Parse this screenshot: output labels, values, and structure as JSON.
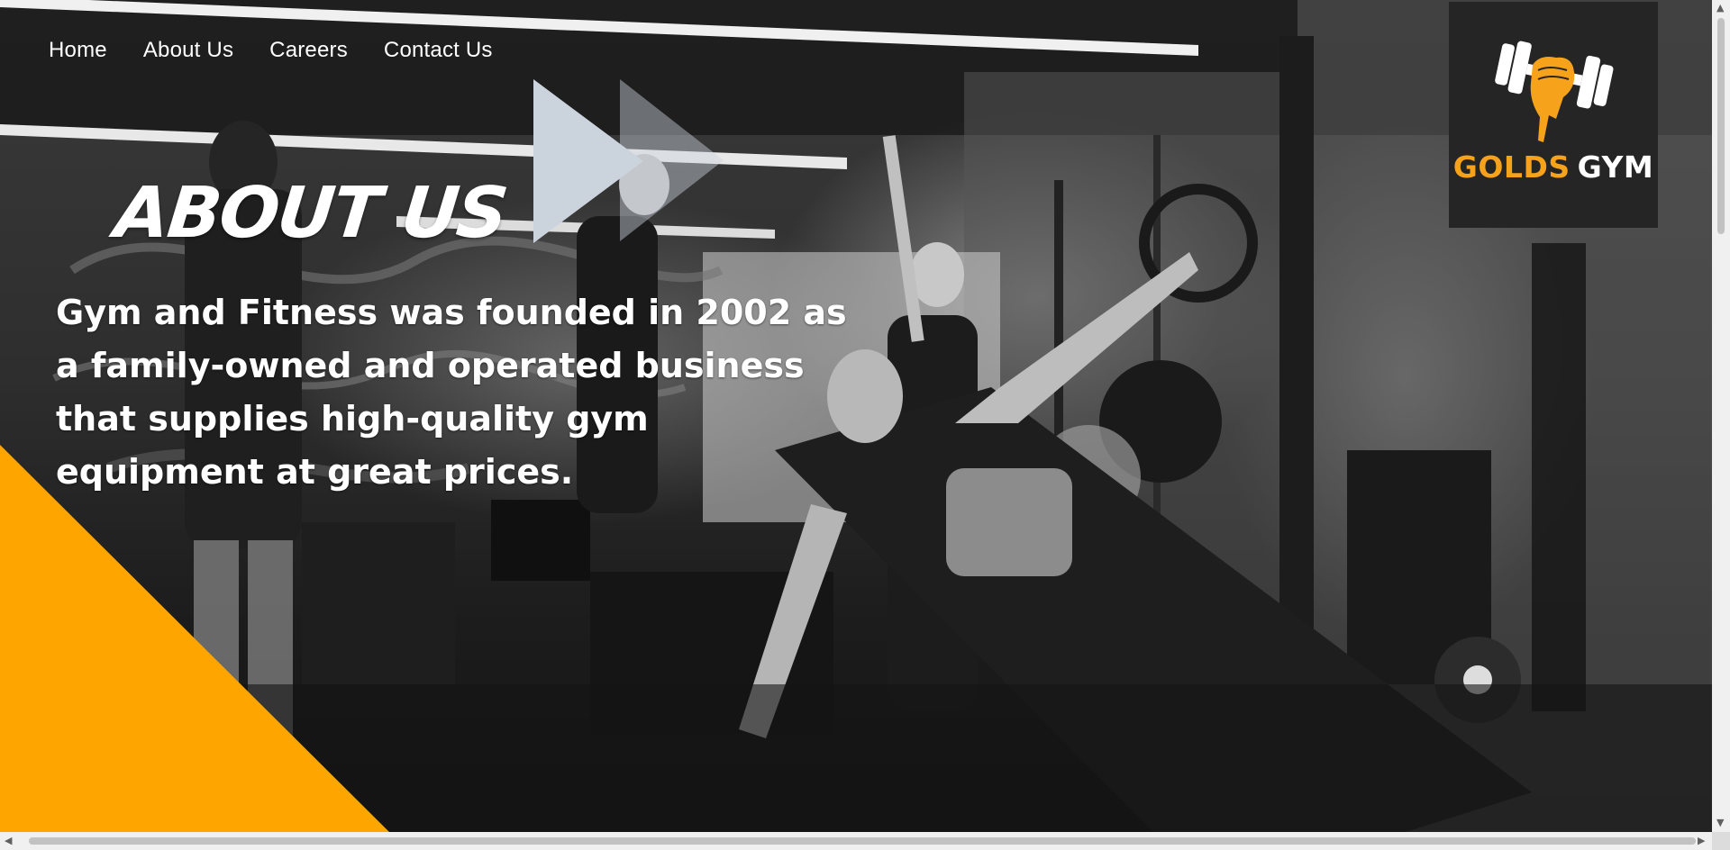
{
  "nav": {
    "items": [
      {
        "label": "Home"
      },
      {
        "label": "About Us"
      },
      {
        "label": "Careers"
      },
      {
        "label": "Contact Us"
      }
    ]
  },
  "hero": {
    "title": "ABOUT US",
    "description": "Gym and Fitness was founded in 2002 as a family-owned and operated business that supplies high-quality gym equipment at great prices."
  },
  "logo": {
    "word1": "GOLDS",
    "word2": "GYM",
    "icon": "dumbbell-fist-icon"
  },
  "colors": {
    "accent_orange": "#ffa500",
    "logo_gold": "#f7a21b",
    "play_arrow": "#cbd3dc",
    "logo_bg": "#252525"
  },
  "icons": {
    "play_arrow": "play-arrow-icon",
    "scroll_up": "chevron-up-icon",
    "scroll_down": "chevron-down-icon",
    "scroll_left": "chevron-left-icon",
    "scroll_right": "chevron-right-icon"
  }
}
